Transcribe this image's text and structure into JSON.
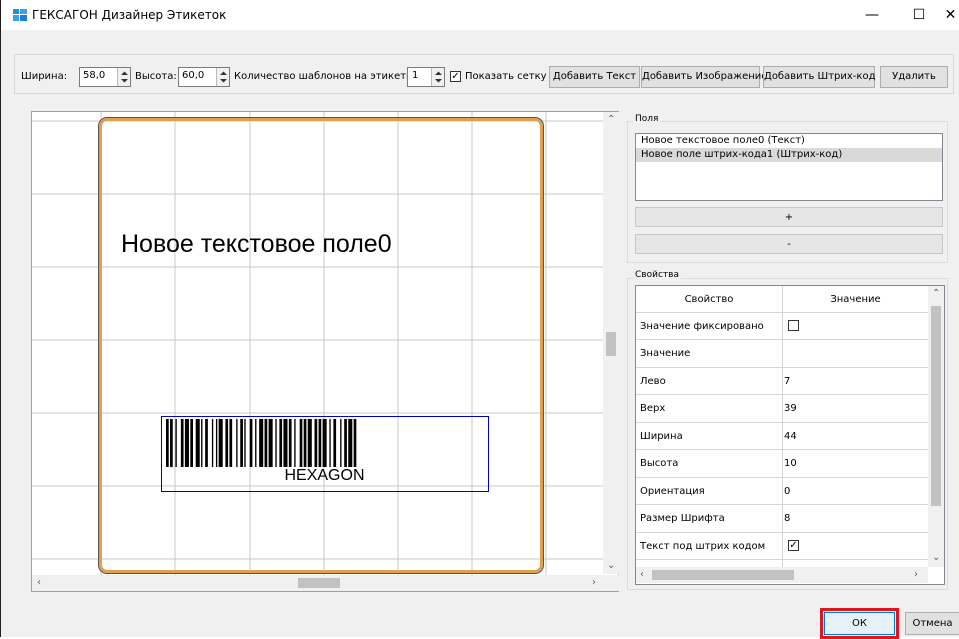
{
  "window": {
    "title": "ГЕКСАГОН Дизайнер Этикеток",
    "minimize": "—",
    "maximize": "☐",
    "close": "✕"
  },
  "toolbar": {
    "width_label": "Ширина:",
    "width_value": "58,0",
    "height_label": "Высота:",
    "height_value": "60,0",
    "count_label": "Количество шаблонов на этикетке:",
    "count_value": "1",
    "show_grid_label": "Показать сетку",
    "show_grid_checked": true,
    "add_text": "Добавить Текст",
    "add_image": "Добавить Изображение",
    "add_barcode": "Добавить Штрих-код",
    "delete": "Удалить"
  },
  "canvas": {
    "text_field": "Новое текстовое поле0",
    "barcode_text": "HEXAGON",
    "label_border_color": "#e0a050",
    "barcode_border_color": "#0000c0"
  },
  "fields": {
    "group_label": "Поля",
    "items": [
      {
        "label": "Новое текстовое поле0 (Текст)",
        "selected": false
      },
      {
        "label": "Новое поле штрих-кода1 (Штрих-код)",
        "selected": true
      }
    ],
    "add_label": "+",
    "remove_label": "-"
  },
  "properties": {
    "group_label": "Свойства",
    "col_property": "Свойство",
    "col_value": "Значение",
    "rows": [
      {
        "name": "Значение фиксировано",
        "value": "",
        "checkbox": true,
        "checked": false
      },
      {
        "name": "Значение",
        "value": ""
      },
      {
        "name": "Лево",
        "value": "7"
      },
      {
        "name": "Верх",
        "value": "39"
      },
      {
        "name": "Ширина",
        "value": "44"
      },
      {
        "name": "Высота",
        "value": "10"
      },
      {
        "name": "Ориентация",
        "value": "0"
      },
      {
        "name": "Размер Шрифта",
        "value": "8"
      },
      {
        "name": "Текст под штрих кодом",
        "value": "",
        "checkbox": true,
        "checked": true
      }
    ]
  },
  "footer": {
    "ok": "ОК",
    "cancel": "Отмена",
    "highlight_color": "#e0161b"
  }
}
